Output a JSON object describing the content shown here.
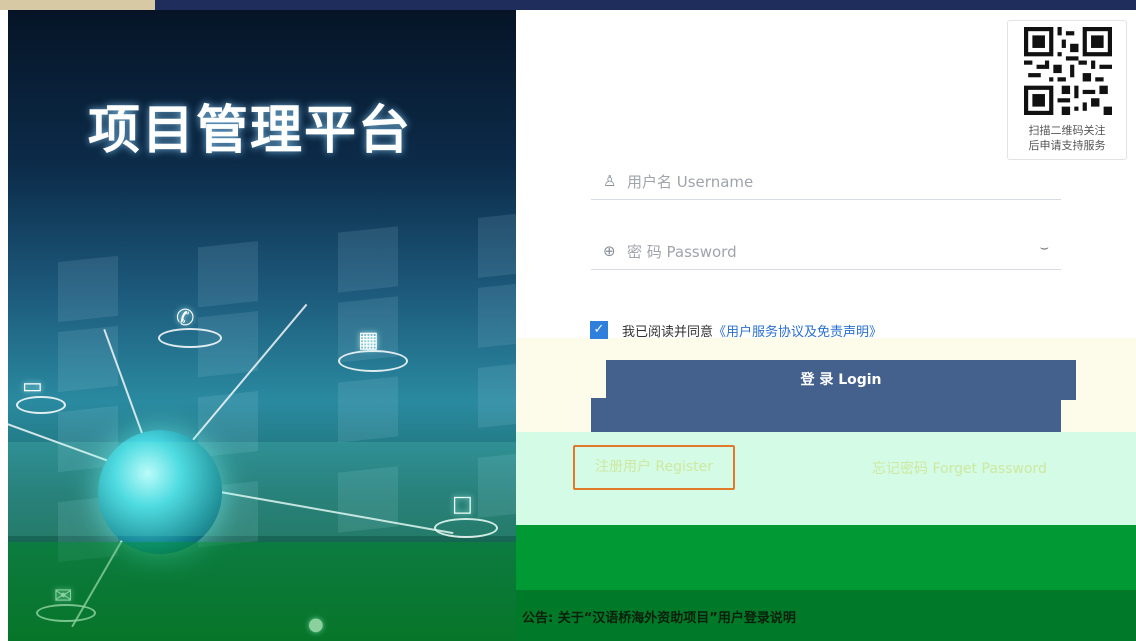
{
  "branding": {
    "app_title": "项目管理平台"
  },
  "qr": {
    "caption_line1": "扫描二维码关注",
    "caption_line2": "后申请支持服务"
  },
  "login_form": {
    "username_placeholder": "用户名 Username",
    "password_placeholder": "密 码 Password",
    "agree_text": "我已阅读并同意",
    "agree_link": "《用户服务协议及免责声明》",
    "agree_checked": true,
    "login_label": "登 录 Login",
    "register_label": "注册用户 Register",
    "forgot_label": "忘记密码 Forget Password"
  },
  "notice": {
    "text": "公告: 关于“汉语桥海外资助项目”用户登录说明"
  },
  "colors": {
    "login_button": "#44608c",
    "link": "#2a6fd1",
    "register_outline": "#e07a2a",
    "checkbox": "#2f7fdc"
  },
  "icons": {
    "username": "user-icon",
    "password": "lock-icon",
    "toggle_password": "eye-closed-icon",
    "checkbox": "check-icon"
  }
}
